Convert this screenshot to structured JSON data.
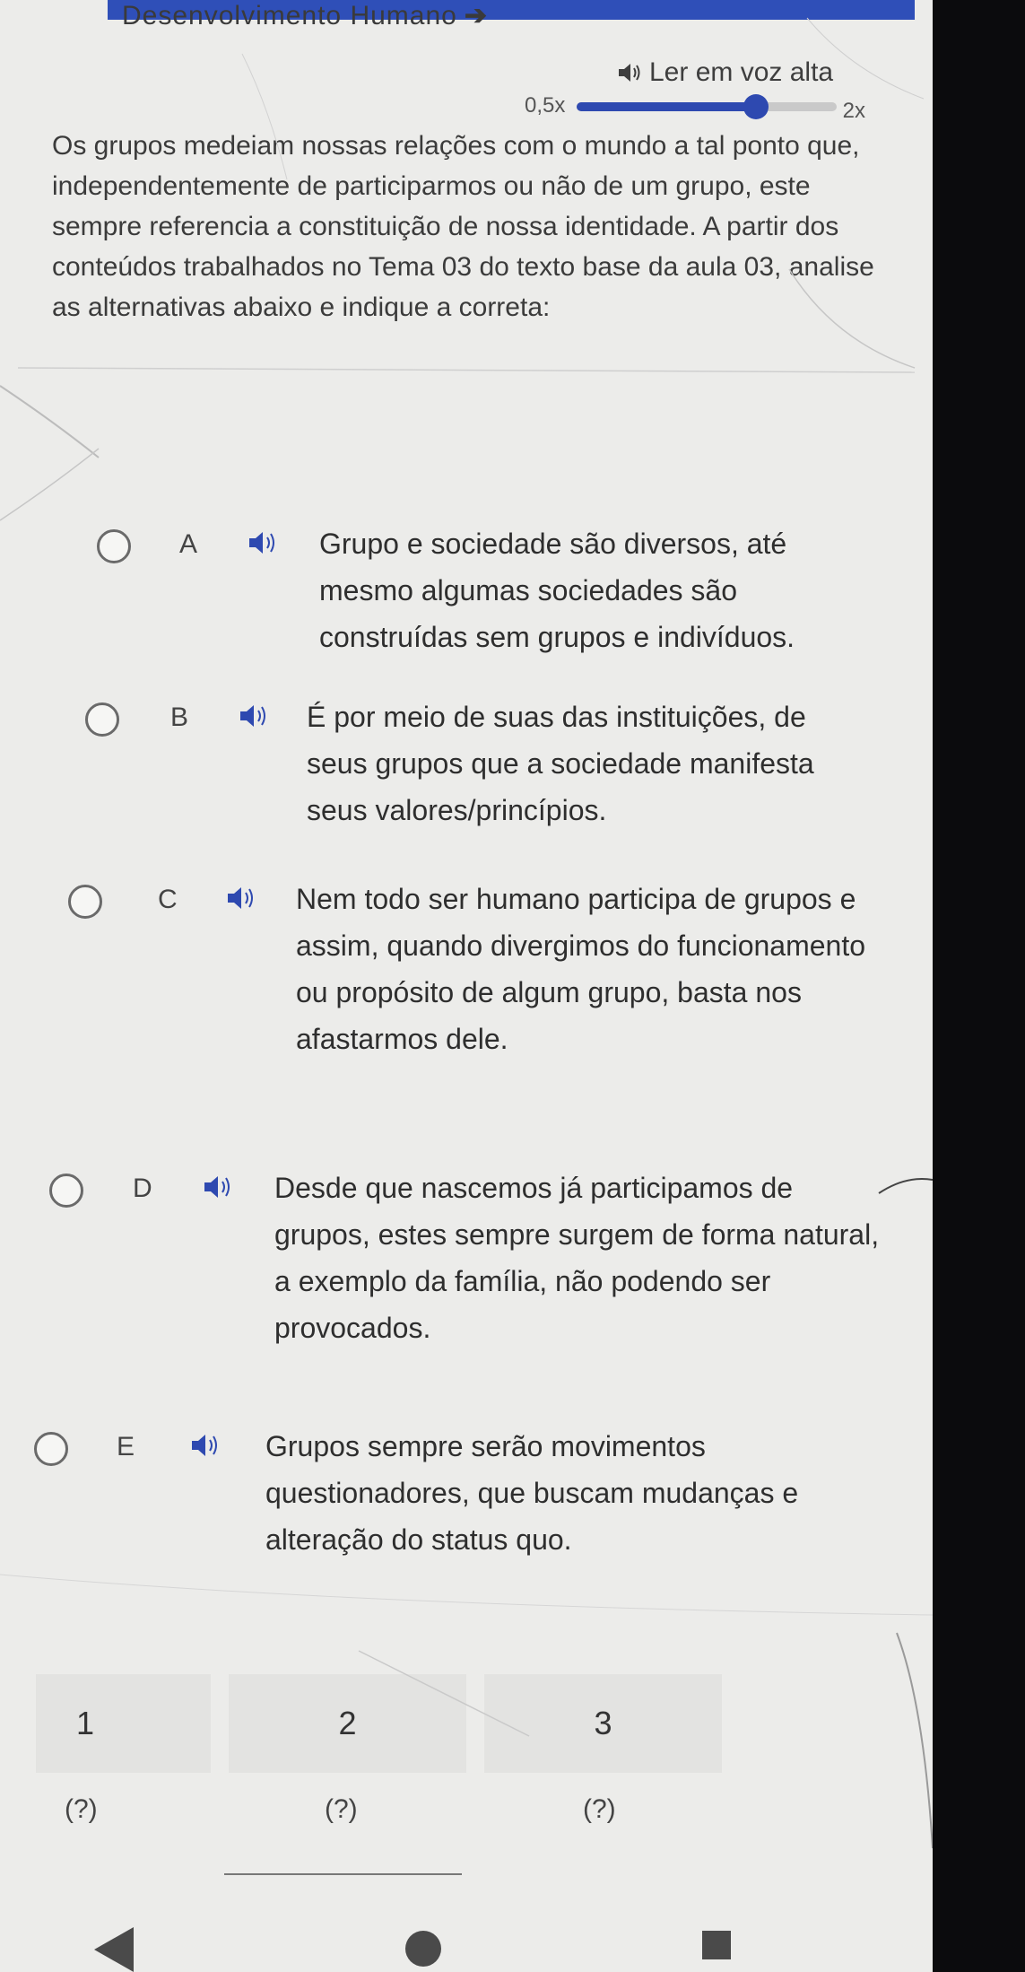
{
  "header": {
    "title": "Desenvolvimento Humano",
    "title_arrow_icon": "arrow-right-icon"
  },
  "tts": {
    "label": "Ler em voz alta",
    "icon": "speaker-icon",
    "speed_min": "0,5x",
    "speed_max": "2x",
    "speed_fraction": 0.69
  },
  "question": {
    "text": "Os grupos medeiam nossas relações com o mundo a tal ponto que, independentemente de participarmos ou não de um grupo, este sempre referencia a constituição de nossa identidade. A partir dos conteúdos trabalhados no Tema 03 do texto base da aula 03, analise as alternativas abaixo e indique a correta:"
  },
  "options": [
    {
      "letter": "A",
      "text": "Grupo e sociedade são diversos, até mesmo algumas sociedades são construídas sem grupos e indivíduos."
    },
    {
      "letter": "B",
      "text": "É por meio de suas das instituições, de seus grupos que a sociedade manifesta seus valores/princípios."
    },
    {
      "letter": "C",
      "text": "Nem todo ser humano participa de grupos e assim, quando divergimos do funcionamento ou propósito de algum grupo, basta nos afastarmos dele."
    },
    {
      "letter": "D",
      "text": "Desde que nascemos já participamos de grupos, estes sempre surgem de forma natural, a exemplo da família, não podendo ser provocados."
    },
    {
      "letter": "E",
      "text": "Grupos sempre serão movimentos questionadores, que buscam mudanças e alteração do status quo."
    }
  ],
  "pagination": {
    "tabs": [
      "1",
      "2",
      "3"
    ],
    "status": [
      "(?)",
      "(?)",
      "(?)"
    ]
  },
  "colors": {
    "accent": "#2e49b0",
    "background": "#ececea"
  }
}
